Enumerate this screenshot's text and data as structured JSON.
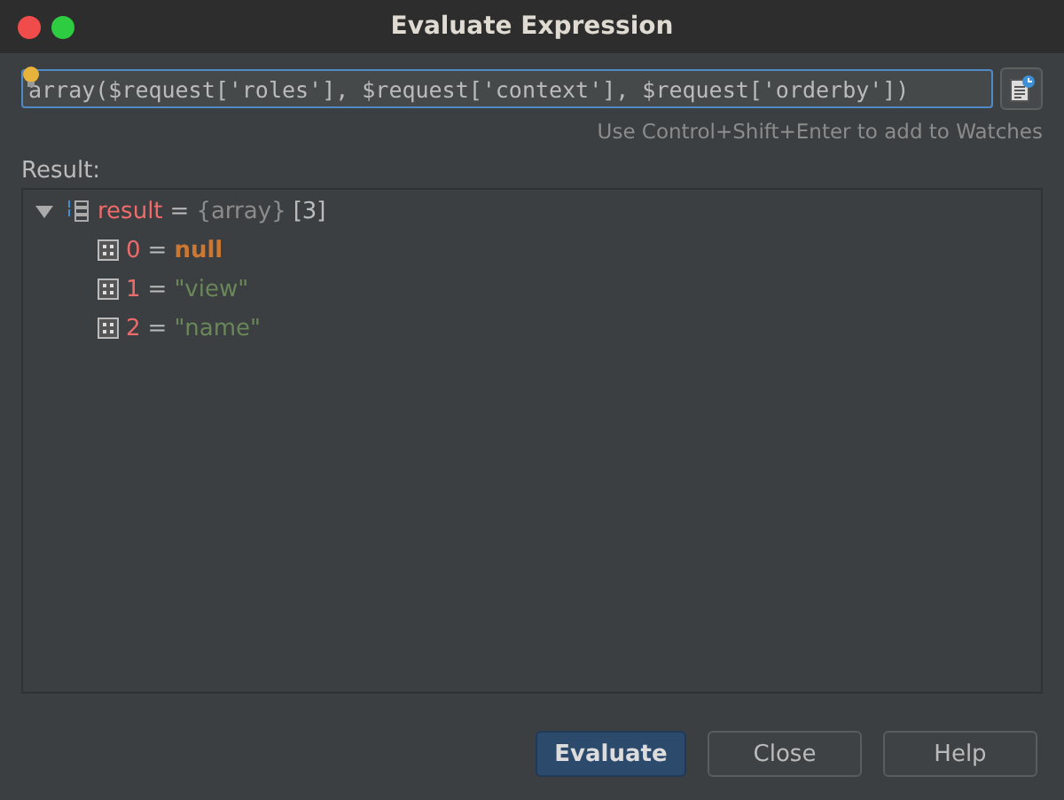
{
  "window": {
    "title": "Evaluate Expression"
  },
  "expression": {
    "value": "array($request['roles'], $request['context'], $request['orderby'])"
  },
  "hint": "Use Control+Shift+Enter to add to Watches",
  "result_label": "Result:",
  "tree": [
    {
      "name": "result",
      "separator": "=",
      "type": "{array}",
      "value": "[3]",
      "kind": "array",
      "expanded": true,
      "children": [
        {
          "name": "0",
          "separator": "=",
          "value": "null",
          "kind": "null"
        },
        {
          "name": "1",
          "separator": "=",
          "value": "\"view\"",
          "kind": "string"
        },
        {
          "name": "2",
          "separator": "=",
          "value": "\"name\"",
          "kind": "string"
        }
      ]
    }
  ],
  "buttons": [
    {
      "label": "Evaluate",
      "kind": "primary"
    },
    {
      "label": "Close",
      "kind": "normal"
    },
    {
      "label": "Help",
      "kind": "normal"
    }
  ]
}
